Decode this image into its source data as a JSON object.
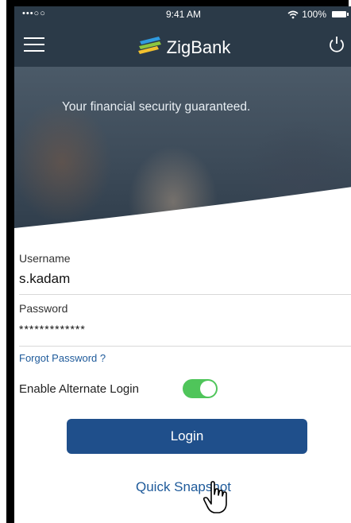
{
  "status_bar": {
    "signal": "•••○○",
    "time": "9:41 AM",
    "battery": "100%"
  },
  "navbar": {
    "brand": "ZigBank"
  },
  "hero": {
    "tagline": "Your financial security guaranteed."
  },
  "login_form": {
    "username_label": "Username",
    "username_value": "s.kadam",
    "password_label": "Password",
    "password_value": "*************",
    "forgot_password": "Forgot Password ?",
    "alternate_login_label": "Enable Alternate Login",
    "alternate_login_enabled": true,
    "login_button": "Login",
    "quick_snapshot": "Quick Snapshot"
  },
  "colors": {
    "header": "#2b3a48",
    "primary_button": "#1f4f8b",
    "link": "#1e5a9a",
    "toggle_on": "#4fc55a"
  },
  "icons": [
    "menu-icon",
    "brand-logo-icon",
    "power-icon",
    "wifi-icon",
    "battery-icon",
    "hand-cursor-icon"
  ]
}
